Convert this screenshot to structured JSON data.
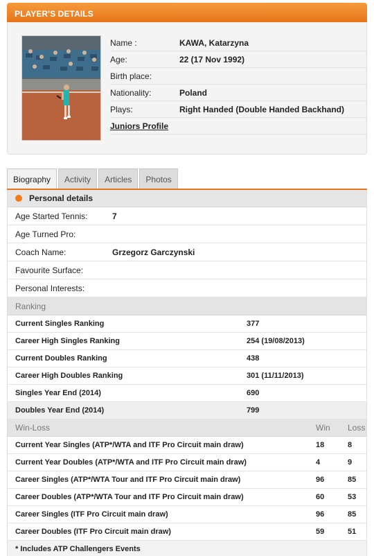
{
  "header": {
    "title": "PLAYER'S DETAILS"
  },
  "player": {
    "name_label": "Name :",
    "name": "KAWA, Katarzyna",
    "age_label": "Age:",
    "age": "22 (17 Nov 1992)",
    "birth_label": "Birth place:",
    "birth": "",
    "nationality_label": "Nationality:",
    "nationality": "Poland",
    "plays_label": "Plays:",
    "plays": "Right Handed (Double Handed Backhand)",
    "juniors_link": "Juniors Profile"
  },
  "tabs": [
    {
      "label": "Biography",
      "active": true
    },
    {
      "label": "Activity",
      "active": false
    },
    {
      "label": "Articles",
      "active": false
    },
    {
      "label": "Photos",
      "active": false
    }
  ],
  "personal": {
    "title": "Personal details",
    "rows": [
      {
        "label": "Age Started Tennis:",
        "value": "7"
      },
      {
        "label": "Age Turned Pro:",
        "value": ""
      },
      {
        "label": "Coach Name:",
        "value": "Grzegorz Garczynski"
      },
      {
        "label": "Favourite Surface:",
        "value": ""
      },
      {
        "label": "Personal Interests:",
        "value": ""
      }
    ]
  },
  "ranking": {
    "title": "Ranking",
    "rows": [
      {
        "label": "Current Singles Ranking",
        "value": "377"
      },
      {
        "label": "Career High Singles Ranking",
        "value": "254 (19/08/2013)"
      },
      {
        "label": "Current Doubles Ranking",
        "value": "438"
      },
      {
        "label": "Career High Doubles Ranking",
        "value": "301 (11/11/2013)"
      },
      {
        "label": "Singles Year End (2014)",
        "value": "690"
      },
      {
        "label": "Doubles Year End (2014)",
        "value": "799"
      }
    ]
  },
  "winloss": {
    "title": "Win-Loss",
    "win_header": "Win",
    "loss_header": "Loss",
    "rows": [
      {
        "label": "Current Year Singles (ATP*/WTA and ITF Pro Circuit main draw)",
        "win": "18",
        "loss": "8"
      },
      {
        "label": "Current Year Doubles (ATP*/WTA and ITF Pro Circuit main draw)",
        "win": "4",
        "loss": "9"
      },
      {
        "label": "Career Singles (ATP*/WTA Tour and ITF Pro Circuit main draw)",
        "win": "96",
        "loss": "85"
      },
      {
        "label": "Career Doubles (ATP*/WTA Tour and ITF Pro Circuit main draw)",
        "win": "60",
        "loss": "53"
      },
      {
        "label": "Career Singles (ITF Pro Circuit main draw)",
        "win": "96",
        "loss": "85"
      },
      {
        "label": "Career Doubles (ITF Pro Circuit main draw)",
        "win": "59",
        "loss": "51"
      }
    ],
    "footnote": "* Includes ATP Challengers Events"
  },
  "colors": {
    "accent": "#e8741a",
    "dot": "#f07c1b"
  }
}
